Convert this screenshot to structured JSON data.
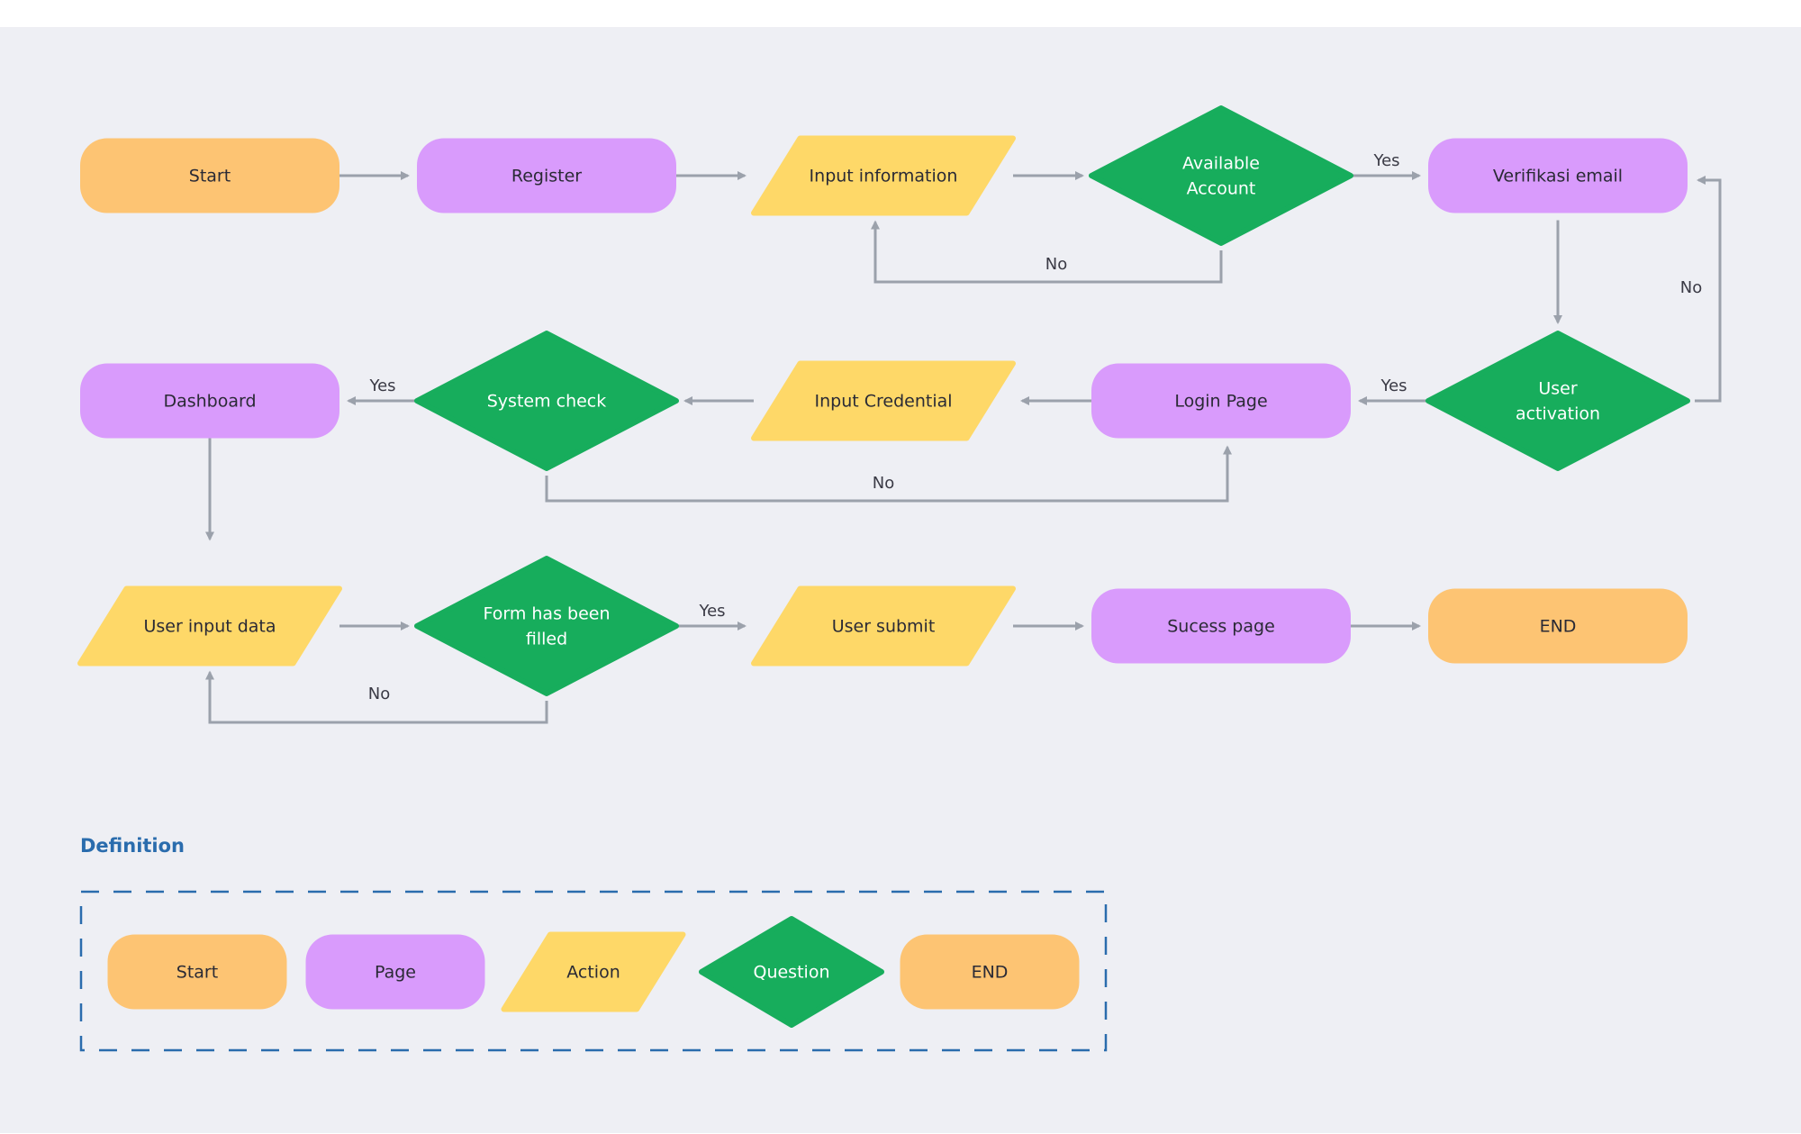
{
  "colors": {
    "background": "#eeeff4",
    "start_end": "#fdc473",
    "page": "#d99bfc",
    "action": "#fed868",
    "question": "#17ad5c",
    "connector": "#9ba1ab",
    "legend_border": "#2a6cad",
    "text_dark": "#2a2a35",
    "text_light": "#ffffff"
  },
  "nodes": [
    {
      "id": "start",
      "type": "start",
      "lines": [
        "Start"
      ]
    },
    {
      "id": "register",
      "type": "page",
      "lines": [
        "Register"
      ]
    },
    {
      "id": "input-information",
      "type": "action",
      "lines": [
        "Input information"
      ]
    },
    {
      "id": "available-account",
      "type": "question",
      "lines": [
        "Available",
        "Account"
      ]
    },
    {
      "id": "verifikasi-email",
      "type": "page",
      "lines": [
        "Verifikasi email"
      ]
    },
    {
      "id": "dashboard",
      "type": "page",
      "lines": [
        "Dashboard"
      ]
    },
    {
      "id": "system-check",
      "type": "question",
      "lines": [
        "System check"
      ]
    },
    {
      "id": "input-credential",
      "type": "action",
      "lines": [
        "Input Credential"
      ]
    },
    {
      "id": "login-page",
      "type": "page",
      "lines": [
        "Login Page"
      ]
    },
    {
      "id": "user-activation",
      "type": "question",
      "lines": [
        "User",
        "activation"
      ]
    },
    {
      "id": "user-input-data",
      "type": "action",
      "lines": [
        "User input data"
      ]
    },
    {
      "id": "form-filled",
      "type": "question",
      "lines": [
        "Form has been",
        "filled"
      ]
    },
    {
      "id": "user-submit",
      "type": "action",
      "lines": [
        "User submit"
      ]
    },
    {
      "id": "sucess-page",
      "type": "page",
      "lines": [
        "Sucess page"
      ]
    },
    {
      "id": "end",
      "type": "end",
      "lines": [
        "END"
      ]
    }
  ],
  "edges": [
    {
      "from": "start",
      "to": "register",
      "label": ""
    },
    {
      "from": "register",
      "to": "input-information",
      "label": ""
    },
    {
      "from": "input-information",
      "to": "available-account",
      "label": ""
    },
    {
      "from": "available-account",
      "to": "verifikasi-email",
      "label": "Yes"
    },
    {
      "from": "available-account",
      "to": "input-information",
      "label": "No"
    },
    {
      "from": "verifikasi-email",
      "to": "user-activation",
      "label": ""
    },
    {
      "from": "user-activation",
      "to": "verifikasi-email",
      "label": "No"
    },
    {
      "from": "user-activation",
      "to": "login-page",
      "label": "Yes"
    },
    {
      "from": "login-page",
      "to": "input-credential",
      "label": ""
    },
    {
      "from": "input-credential",
      "to": "system-check",
      "label": ""
    },
    {
      "from": "system-check",
      "to": "dashboard",
      "label": "Yes"
    },
    {
      "from": "system-check",
      "to": "login-page",
      "label": "No"
    },
    {
      "from": "dashboard",
      "to": "user-input-data",
      "label": ""
    },
    {
      "from": "user-input-data",
      "to": "form-filled",
      "label": ""
    },
    {
      "from": "form-filled",
      "to": "user-submit",
      "label": "Yes"
    },
    {
      "from": "form-filled",
      "to": "user-input-data",
      "label": "No"
    },
    {
      "from": "user-submit",
      "to": "sucess-page",
      "label": ""
    },
    {
      "from": "sucess-page",
      "to": "end",
      "label": ""
    }
  ],
  "legend": {
    "title": "Definition",
    "items": [
      {
        "type": "start",
        "label": "Start"
      },
      {
        "type": "page",
        "label": "Page"
      },
      {
        "type": "action",
        "label": "Action"
      },
      {
        "type": "question",
        "label": "Question"
      },
      {
        "type": "end",
        "label": "END"
      }
    ]
  }
}
